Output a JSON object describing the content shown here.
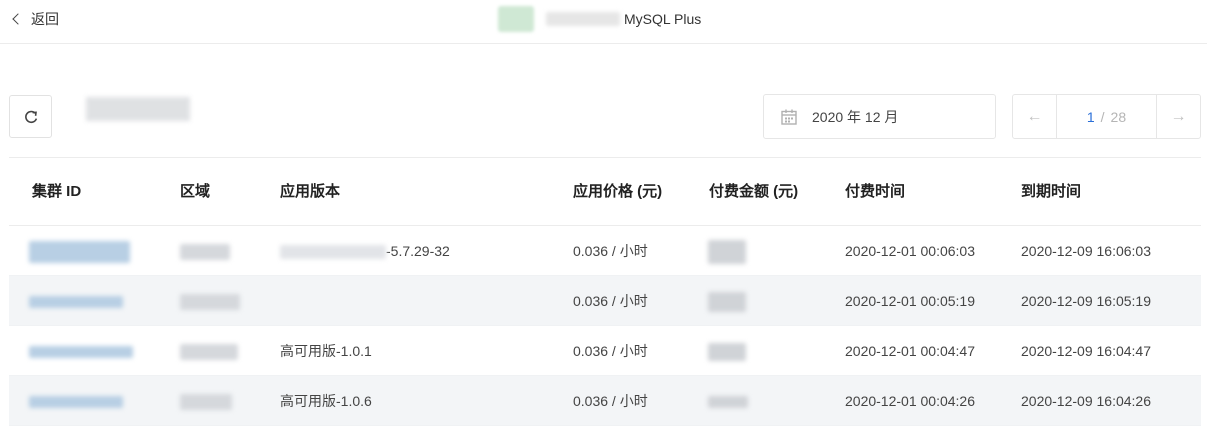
{
  "header": {
    "back_label": "返回",
    "app_name": "MySQL Plus"
  },
  "toolbar": {
    "date_label": "2020 年 12 月",
    "pager": {
      "current": "1",
      "separator": "/",
      "total": "28",
      "prev_icon": "arrow-left-icon",
      "next_icon": "arrow-right-icon"
    }
  },
  "table": {
    "columns": [
      "集群 ID",
      "区域",
      "应用版本",
      "应用价格 (元)",
      "付费金额 (元)",
      "付费时间",
      "到期时间"
    ],
    "rows": [
      {
        "version": "-5.7.29-32",
        "price": "0.036 / 小时",
        "paid_time": "2020-12-01 00:06:03",
        "expire_time": "2020-12-09 16:06:03"
      },
      {
        "version": "",
        "price": "0.036 / 小时",
        "paid_time": "2020-12-01 00:05:19",
        "expire_time": "2020-12-09 16:05:19"
      },
      {
        "version": "高可用版-1.0.1",
        "price": "0.036 / 小时",
        "paid_time": "2020-12-01 00:04:47",
        "expire_time": "2020-12-09 16:04:47"
      },
      {
        "version": "高可用版-1.0.6",
        "price": "0.036 / 小时",
        "paid_time": "2020-12-01 00:04:26",
        "expire_time": "2020-12-09 16:04:26"
      }
    ]
  },
  "colors": {
    "accent": "#2a6fd8",
    "row_alt": "#f3f5f7",
    "border": "#ececec"
  }
}
